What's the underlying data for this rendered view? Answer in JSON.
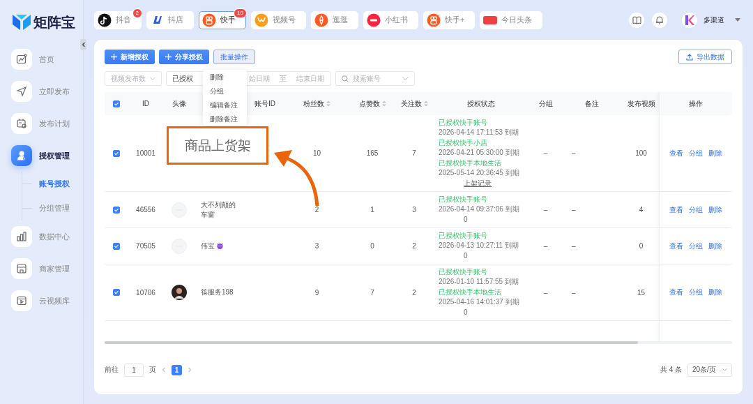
{
  "app": {
    "logo_text": "矩阵宝"
  },
  "sidebar": {
    "items": [
      {
        "label": "首页",
        "kind": "chart",
        "selected": false
      },
      {
        "label": "立即发布",
        "kind": "send",
        "selected": false
      },
      {
        "label": "发布计划",
        "kind": "calendar",
        "selected": false
      },
      {
        "label": "授权管理",
        "kind": "user",
        "selected": true,
        "children": [
          {
            "label": "账号授权",
            "selected": true
          },
          {
            "label": "分组管理",
            "selected": false
          }
        ]
      },
      {
        "label": "数据中心",
        "kind": "bars",
        "selected": false
      },
      {
        "label": "商家管理",
        "kind": "store",
        "selected": false
      },
      {
        "label": "云视频库",
        "kind": "video",
        "selected": false
      }
    ]
  },
  "platform_tabs": [
    {
      "label": "抖音",
      "kind": "douyin",
      "badge": "2",
      "selected": false
    },
    {
      "label": "抖店",
      "kind": "doudian",
      "selected": false
    },
    {
      "label": "快手",
      "kind": "kuaishou",
      "badge": "10",
      "selected": true
    },
    {
      "label": "视频号",
      "kind": "shipinhao",
      "selected": false
    },
    {
      "label": "逛逛",
      "kind": "guangguang",
      "selected": false
    },
    {
      "label": "小红书",
      "kind": "xiaohongshu",
      "selected": false
    },
    {
      "label": "快手+",
      "kind": "kuaishouplus",
      "selected": false
    },
    {
      "label": "今日头条",
      "kind": "toutiao",
      "selected": false
    }
  ],
  "user": {
    "name": "多渠道"
  },
  "toolbar": {
    "buttons": [
      {
        "label": "新增授权",
        "kind": "primary"
      },
      {
        "label": "分享授权",
        "kind": "primary"
      },
      {
        "label": "批量操作",
        "kind": "batch"
      }
    ],
    "export_button": "导出数据"
  },
  "batch_menu": {
    "items": [
      "删除",
      "分组",
      "编辑备注",
      "删除备注"
    ]
  },
  "filters": {
    "video_count": {
      "placeholder": "视频发布数"
    },
    "auth_status": {
      "value": "已授权"
    },
    "date_range": {
      "start_placeholder": "始日期",
      "separator": "至",
      "end_placeholder": "结束日期"
    },
    "search": {
      "placeholder": "搜索账号"
    }
  },
  "table": {
    "header_checked": true,
    "columns": [
      {
        "label": "ID",
        "sortable": false
      },
      {
        "label": "头像",
        "sortable": false
      },
      {},
      {
        "label": "账号ID",
        "sortable": false
      },
      {
        "label": "粉丝数",
        "sortable": true
      },
      {
        "label": "点赞数",
        "sortable": true
      },
      {
        "label": "关注数",
        "sortable": true
      },
      {
        "label": "授权状态",
        "sortable": false
      },
      {
        "label": "分组",
        "sortable": false
      },
      {
        "label": "备注",
        "sortable": false
      },
      {
        "label": "发布视频",
        "sortable": false
      },
      {
        "label": "操作",
        "sortable": false
      }
    ],
    "rows": [
      {
        "checked": true,
        "id": "10001",
        "fans": "10",
        "likes": "165",
        "follows": "7",
        "statuses": [
          {
            "label": "已授权快手账号",
            "expiry": "2026-04-14 17:11:53 到期"
          },
          {
            "label": "已授权快手小店",
            "expiry": "2026-04-21 05:30:00 到期"
          },
          {
            "label": "已授权快手本地生活",
            "expiry": "2025-05-14 20:36:45 到期"
          }
        ],
        "status_footer": {
          "kind": "link",
          "text": "上架记录"
        },
        "group": "–",
        "remark": "–",
        "videos": "100",
        "actions": [
          "查看",
          "分组",
          "删除"
        ]
      },
      {
        "checked": true,
        "id": "46556",
        "avatar": {
          "kind": "placeholder"
        },
        "nickname": "大不列颠的车窗",
        "fans": "2",
        "likes": "1",
        "follows": "3",
        "statuses": [
          {
            "label": "已授权快手账号",
            "expiry": "2026-04-14 09:37:06 到期"
          }
        ],
        "status_footer": {
          "kind": "count",
          "text": "0"
        },
        "group": "–",
        "remark": "–",
        "videos": "4",
        "actions": [
          "查看",
          "分组",
          "删除"
        ]
      },
      {
        "checked": true,
        "id": "70505",
        "avatar": {
          "kind": "placeholder"
        },
        "nickname": "伟宝",
        "nickname_badge": true,
        "fans": "3",
        "likes": "0",
        "follows": "2",
        "statuses": [
          {
            "label": "已授权快手账号",
            "expiry": "2026-04-13 10:27:11 到期"
          }
        ],
        "status_footer": {
          "kind": "count",
          "text": "0"
        },
        "group": "–",
        "remark": "–",
        "videos": "0",
        "actions": [
          "查看",
          "分组",
          "删除"
        ]
      },
      {
        "checked": true,
        "id": "10706",
        "avatar": {
          "kind": "photo"
        },
        "nickname": "筷服务198",
        "fans": "9",
        "likes": "7",
        "follows": "2",
        "statuses": [
          {
            "label": "已授权快手账号",
            "expiry": "2026-01-10 11:57:55 到期"
          },
          {
            "label": "已授权快手本地生活",
            "expiry": "2025-04-16 14:01:37 到期"
          }
        ],
        "status_footer": {
          "kind": "count",
          "text": "0"
        },
        "group": "–",
        "remark": "–",
        "videos": "15",
        "actions": [
          "查看",
          "分组",
          "删除"
        ]
      }
    ]
  },
  "pagination": {
    "goto_label": "前往",
    "page_input": "1",
    "page_suffix": "页",
    "pages": [
      {
        "label": "1",
        "selected": true
      }
    ],
    "total": "共 4 条",
    "page_size": "20条/页"
  },
  "callout": {
    "text": "商品上货架"
  }
}
